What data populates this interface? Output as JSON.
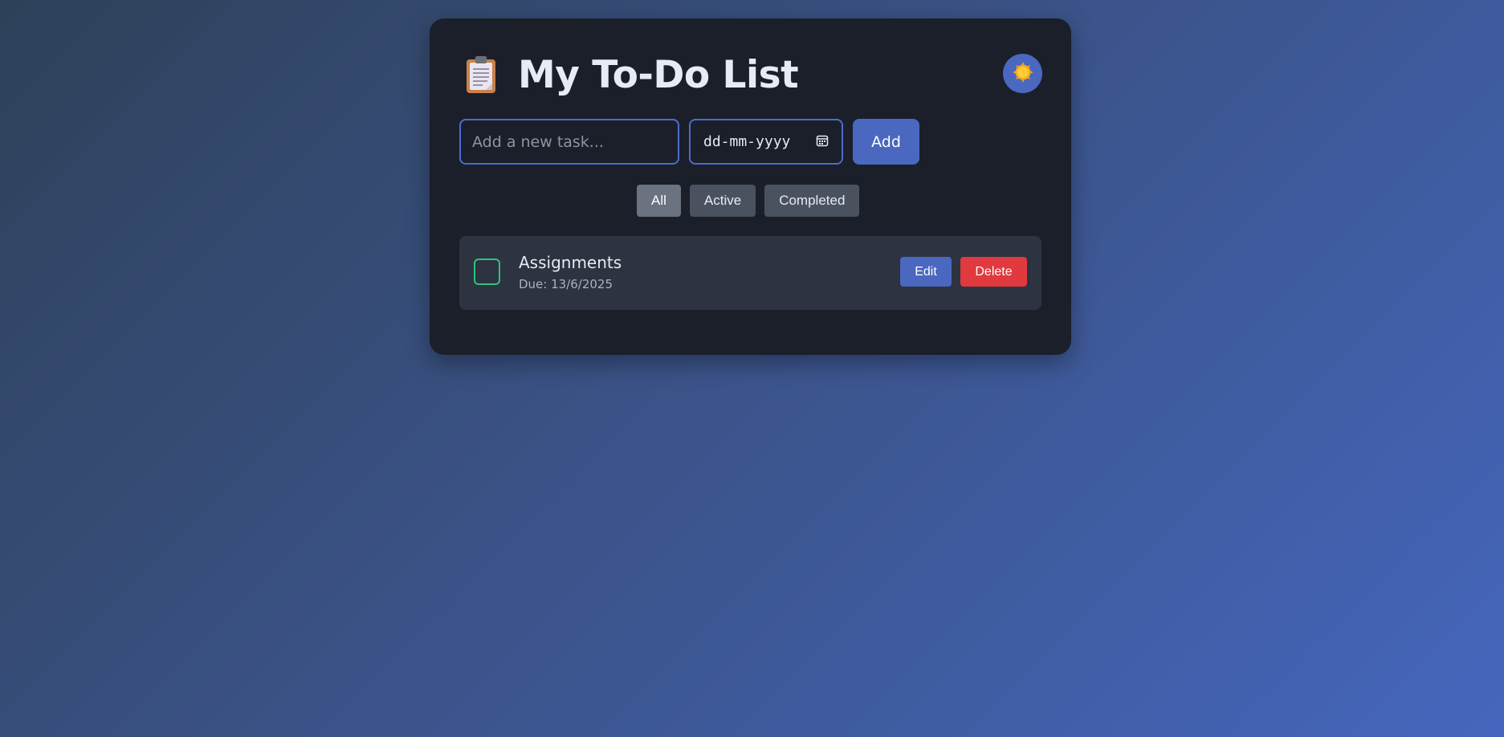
{
  "header": {
    "title": "My To-Do List",
    "icon": "clipboard-icon",
    "theme_toggle_icon": "sun-icon"
  },
  "new_task": {
    "placeholder": "Add a new task...",
    "value": "",
    "date_placeholder": "dd-mm-yyyy",
    "date_icon": "calendar-icon",
    "add_label": "Add"
  },
  "filters": [
    {
      "label": "All",
      "active": true
    },
    {
      "label": "Active",
      "active": false
    },
    {
      "label": "Completed",
      "active": false
    }
  ],
  "tasks": [
    {
      "name": "Assignments",
      "due": "Due: 13/6/2025",
      "completed": false,
      "edit_label": "Edit",
      "delete_label": "Delete"
    }
  ],
  "colors": {
    "accent": "#4a68bf",
    "danger": "#e0393e",
    "success": "#2ec27e",
    "card_bg": "#1b1f2a",
    "item_bg": "#2d3340"
  }
}
